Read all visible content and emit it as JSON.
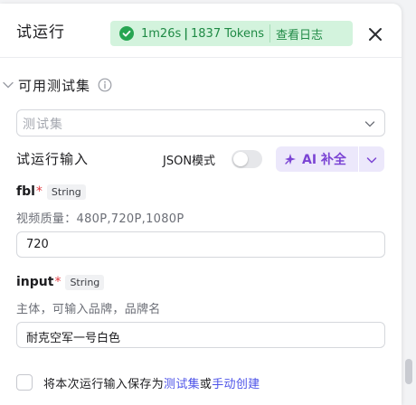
{
  "header": {
    "title": "试运行",
    "status": {
      "time": "1m26s",
      "separator": "|",
      "tokens": "1837 Tokens",
      "log_link": "查看日志"
    }
  },
  "testset_section": {
    "title": "可用测试集",
    "select_placeholder": "测试集"
  },
  "run_input": {
    "label": "试运行输入",
    "json_mode_label": "JSON模式",
    "json_mode_on": false,
    "ai_button_label": "AI 补全"
  },
  "fields": [
    {
      "name": "fbl",
      "required_mark": "*",
      "type": "String",
      "description": "视频质量：480P,720P,1080P",
      "value": "720"
    },
    {
      "name": "input",
      "required_mark": "*",
      "type": "String",
      "description": "主体，可输入品牌，品牌名",
      "value": "耐克空军一号白色"
    }
  ],
  "footer": {
    "save_prefix": "将本次运行输入保存为",
    "save_link": "测试集",
    "connector": "或",
    "manual_link": "手动创建",
    "checked": false
  },
  "colors": {
    "success_badge_bg": "#d3f3dd",
    "success_text": "#1f8a45",
    "ai_accent": "#7b44d4",
    "link": "#4d53e8",
    "required": "#e0383e"
  },
  "icons": [
    "check-circle-icon",
    "close-icon",
    "chevron-down-icon",
    "info-icon",
    "sparkle-icon"
  ]
}
